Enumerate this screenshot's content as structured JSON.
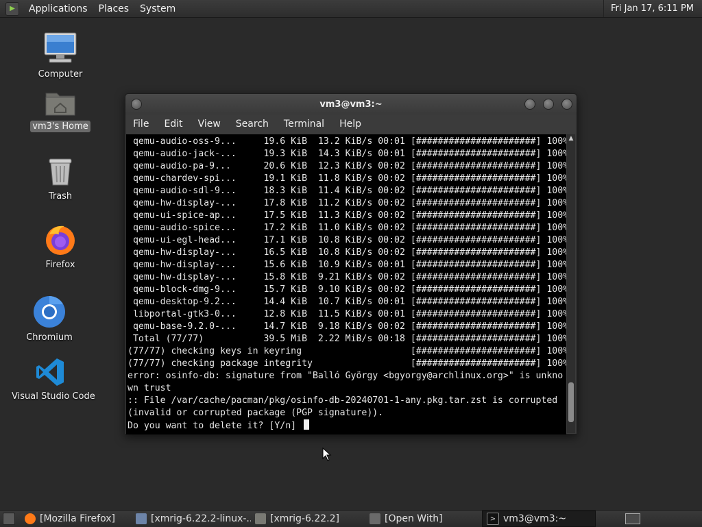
{
  "top_panel": {
    "menus": [
      "Applications",
      "Places",
      "System"
    ],
    "clock": "Fri Jan 17,  6:11 PM"
  },
  "desktop_icons": {
    "computer": "Computer",
    "home": "vm3's Home",
    "trash": "Trash",
    "firefox": "Firefox",
    "chromium": "Chromium",
    "vscode": "Visual Studio Code"
  },
  "terminal": {
    "title": "vm3@vm3:~",
    "menu": [
      "File",
      "Edit",
      "View",
      "Search",
      "Terminal",
      "Help"
    ],
    "lines": [
      " qemu-audio-oss-9...     19.6 KiB  13.2 KiB/s 00:01 [######################] 100%",
      " qemu-audio-jack-...     19.3 KiB  14.3 KiB/s 00:01 [######################] 100%",
      " qemu-audio-pa-9...      20.6 KiB  12.3 KiB/s 00:02 [######################] 100%",
      " qemu-chardev-spi...     19.1 KiB  11.8 KiB/s 00:02 [######################] 100%",
      " qemu-audio-sdl-9...     18.3 KiB  11.4 KiB/s 00:02 [######################] 100%",
      " qemu-hw-display-...     17.8 KiB  11.2 KiB/s 00:02 [######################] 100%",
      " qemu-ui-spice-ap...     17.5 KiB  11.3 KiB/s 00:02 [######################] 100%",
      " qemu-audio-spice...     17.2 KiB  11.0 KiB/s 00:02 [######################] 100%",
      " qemu-ui-egl-head...     17.1 KiB  10.8 KiB/s 00:02 [######################] 100%",
      " qemu-hw-display-...     16.5 KiB  10.8 KiB/s 00:02 [######################] 100%",
      " qemu-hw-display-...     15.6 KiB  10.9 KiB/s 00:01 [######################] 100%",
      " qemu-hw-display-...     15.8 KiB  9.21 KiB/s 00:02 [######################] 100%",
      " qemu-block-dmg-9...     15.7 KiB  9.10 KiB/s 00:02 [######################] 100%",
      " qemu-desktop-9.2...     14.4 KiB  10.7 KiB/s 00:01 [######################] 100%",
      " libportal-gtk3-0...     12.8 KiB  11.5 KiB/s 00:01 [######################] 100%",
      " qemu-base-9.2.0-...     14.7 KiB  9.18 KiB/s 00:02 [######################] 100%",
      " Total (77/77)           39.5 MiB  2.22 MiB/s 00:18 [######################] 100%",
      "(77/77) checking keys in keyring                    [######################] 100%",
      "(77/77) checking package integrity                  [######################] 100%",
      "error: osinfo-db: signature from \"Balló György <bgyorgy@archlinux.org>\" is unkno",
      "wn trust",
      ":: File /var/cache/pacman/pkg/osinfo-db-20240701-1-any.pkg.tar.zst is corrupted",
      "(invalid or corrupted package (PGP signature)).",
      "Do you want to delete it? [Y/n] "
    ]
  },
  "taskbar": {
    "items": [
      "[Mozilla Firefox]",
      "[xmrig-6.22.2-linux-...",
      "[xmrig-6.22.2]",
      "[Open With]",
      "vm3@vm3:~"
    ]
  }
}
